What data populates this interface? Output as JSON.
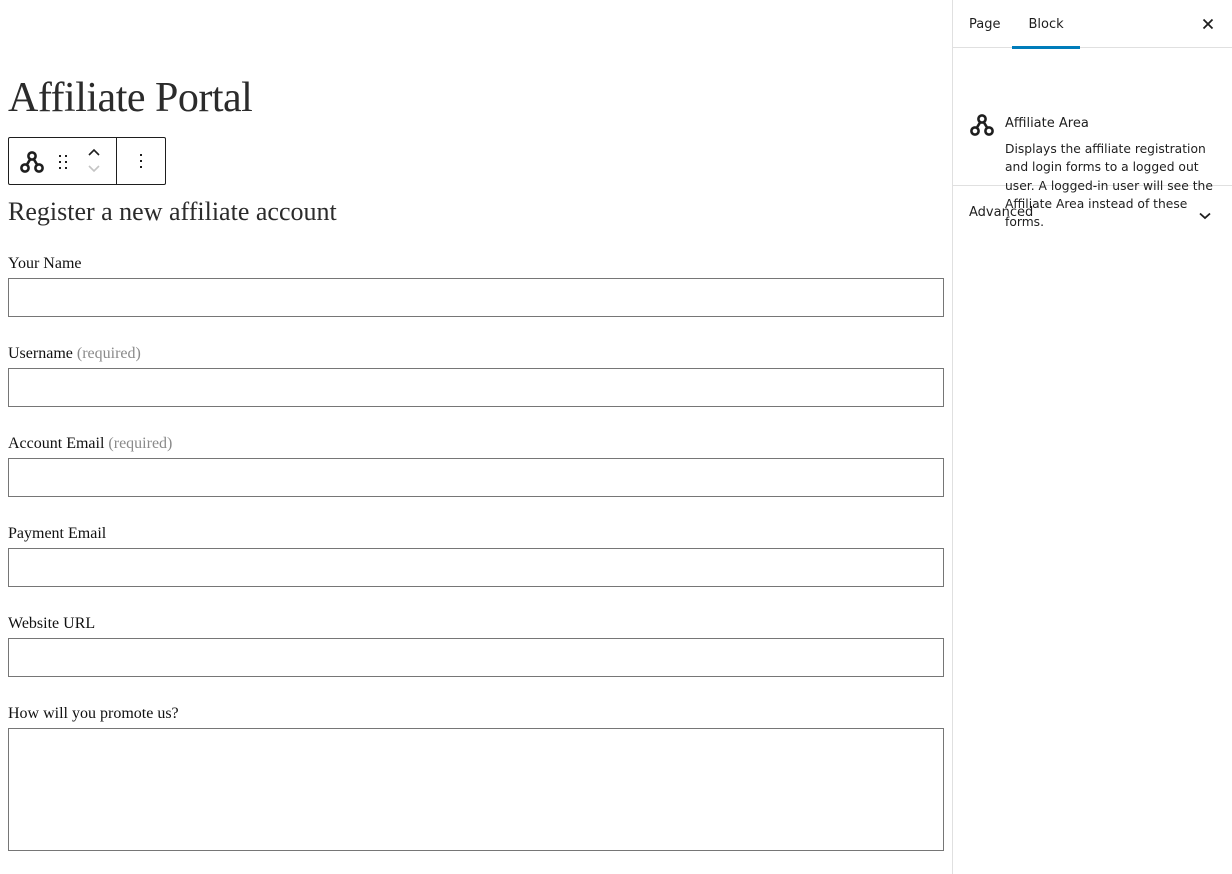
{
  "page": {
    "title": "Affiliate Portal"
  },
  "toolbar": {
    "block_icon": "affiliate-area-icon",
    "drag_icon": "drag-handle-icon",
    "move_up_icon": "chevron-up-icon",
    "move_down_icon": "chevron-down-icon",
    "more_icon": "more-vertical-icon"
  },
  "form": {
    "heading": "Register a new affiliate account",
    "fields": [
      {
        "label": "Your Name",
        "required_note": "",
        "value": "",
        "type": "text"
      },
      {
        "label": "Username",
        "required_note": "(required)",
        "value": "",
        "type": "text"
      },
      {
        "label": "Account Email",
        "required_note": "(required)",
        "value": "",
        "type": "text"
      },
      {
        "label": "Payment Email",
        "required_note": "",
        "value": "",
        "type": "text"
      },
      {
        "label": "Website URL",
        "required_note": "",
        "value": "",
        "type": "text"
      },
      {
        "label": "How will you promote us?",
        "required_note": "",
        "value": "",
        "type": "textarea"
      }
    ]
  },
  "sidebar": {
    "tabs": [
      {
        "label": "Page",
        "active": false
      },
      {
        "label": "Block",
        "active": true
      }
    ],
    "close_icon": "close-icon",
    "accent_color": "#007cba",
    "block_card": {
      "icon": "affiliate-area-icon",
      "title": "Affiliate Area",
      "description": "Displays the affiliate registration and login forms to a logged out user. A logged-in user will see the Affiliate Area instead of these forms."
    },
    "panels": [
      {
        "title": "Advanced",
        "icon": "chevron-down-icon",
        "expanded": false
      }
    ]
  }
}
